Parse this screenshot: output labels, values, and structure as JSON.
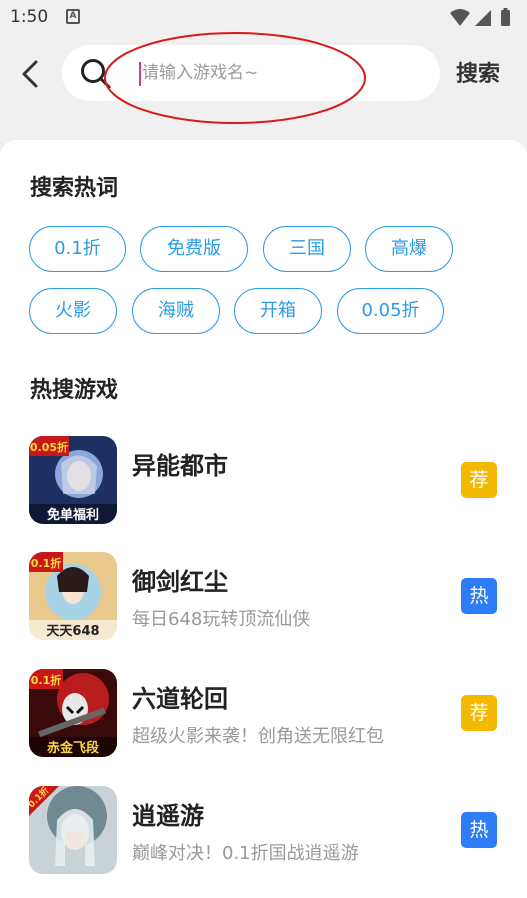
{
  "status_bar": {
    "time": "1:50",
    "notification_glyph": "A"
  },
  "header": {
    "placeholder": "请输入游戏名~",
    "search_label": "搜索"
  },
  "hot_words": {
    "title": "搜索热词",
    "tags": [
      "0.1折",
      "免费版",
      "三国",
      "高爆",
      "火影",
      "海贼",
      "开箱",
      "0.05折"
    ]
  },
  "hot_games": {
    "title": "热搜游戏",
    "items": [
      {
        "name": "异能都市",
        "desc": "",
        "badge": "荐",
        "badge_color": "#f5b800",
        "icon_corner": "0.05折",
        "icon_caption": "免单福利",
        "icon_palette": [
          "#1d2f63",
          "#8aa6dc"
        ]
      },
      {
        "name": "御剑红尘",
        "desc": "每日648玩转顶流仙侠",
        "badge": "热",
        "badge_color": "#2f7df6",
        "icon_corner": "0.1折",
        "icon_caption": "天天648",
        "icon_palette": [
          "#e9c98e",
          "#a7d3e6"
        ]
      },
      {
        "name": "六道轮回",
        "desc": "超级火影来袭！创角送无限红包",
        "badge": "荐",
        "badge_color": "#f5b800",
        "icon_corner": "0.1折",
        "icon_caption": "赤金飞段",
        "icon_palette": [
          "#3a0a0a",
          "#b81d1d"
        ]
      },
      {
        "name": "逍遥游",
        "desc": "巅峰对决！0.1折国战逍遥游",
        "badge": "热",
        "badge_color": "#2f7df6",
        "icon_corner": "0.1折",
        "icon_caption": "",
        "icon_palette": [
          "#c9d3d6",
          "#6f8a93"
        ]
      }
    ]
  },
  "colors": {
    "accent": "#2a9be4",
    "annotation": "#d91a1a",
    "caret": "#d23c8a"
  }
}
